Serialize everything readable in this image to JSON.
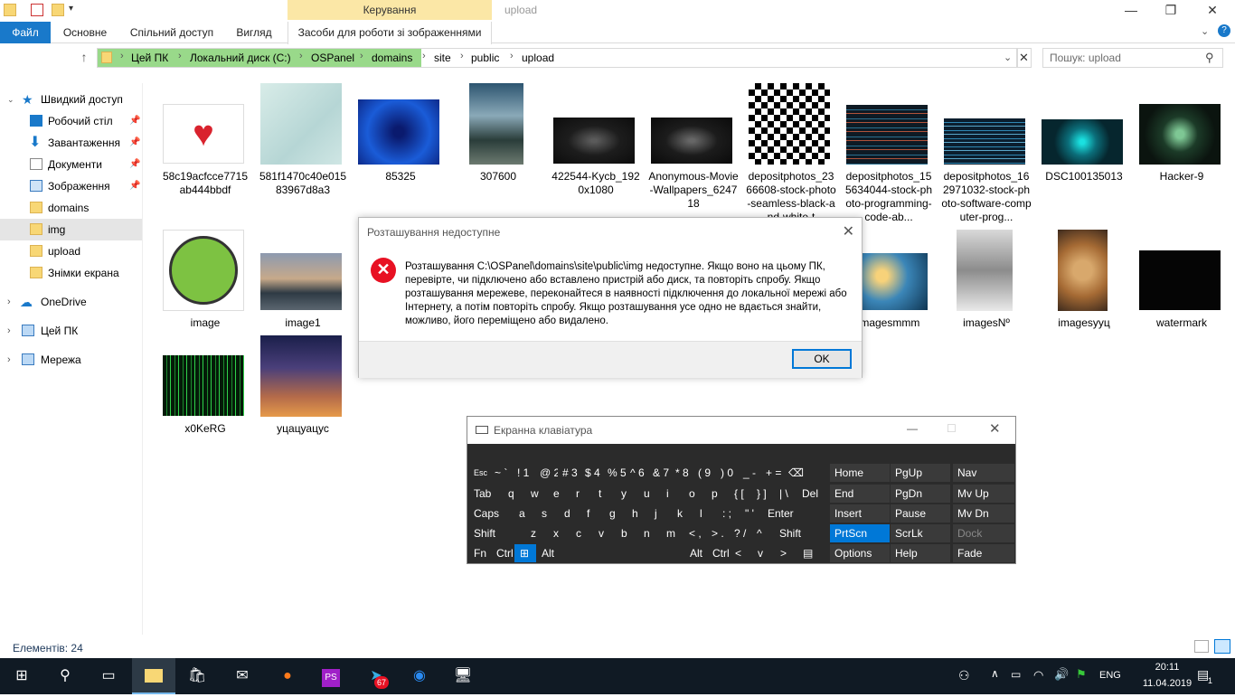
{
  "window": {
    "title": "upload",
    "manage_tab": "Керування"
  },
  "ribbon": {
    "tabs": [
      "Файл",
      "Основне",
      "Спільний доступ",
      "Вигляд",
      "Засоби для роботи зі зображеннями"
    ]
  },
  "address": {
    "crumbs": [
      "Цей ПК",
      "Локальний диск (C:)",
      "OSPanel",
      "domains",
      "site",
      "public",
      "upload"
    ]
  },
  "search": {
    "placeholder": "Пошук: upload"
  },
  "sidebar": {
    "quick_access": "Швидкий доступ",
    "items": [
      "Робочий стіл",
      "Завантаження",
      "Документи",
      "Зображення",
      "domains",
      "img",
      "upload",
      "Знімки екрана"
    ],
    "onedrive": "OneDrive",
    "this_pc": "Цей ПК",
    "network": "Мережа"
  },
  "files": [
    {
      "name": "58c19acfcce7715ab444bbdf"
    },
    {
      "name": "581f1470c40e01583967d8a3"
    },
    {
      "name": "85325"
    },
    {
      "name": "307600"
    },
    {
      "name": "422544-Kycb_1920x1080"
    },
    {
      "name": "Anonymous-Movie-Wallpapers_624718"
    },
    {
      "name": "depositphotos_2366608-stock-photo-seamless-black-and-white-t"
    },
    {
      "name": "depositphotos_155634044-stock-photo-programming-code-ab..."
    },
    {
      "name": "depositphotos_162971032-stock-photo-software-computer-prog..."
    },
    {
      "name": "DSC100135013"
    },
    {
      "name": "Hacker-9"
    },
    {
      "name": "image"
    },
    {
      "name": "image1"
    },
    {
      "name": "imagesmmm"
    },
    {
      "name": "imagesNº"
    },
    {
      "name": "imagesyyц"
    },
    {
      "name": "watermark"
    },
    {
      "name": "x0KeRG"
    },
    {
      "name": "уцацуацус"
    }
  ],
  "status": {
    "count_text": "Елементів: 24"
  },
  "dialog": {
    "title": "Розташування недоступне",
    "message": "Розташування C:\\OSPanel\\domains\\site\\public\\img недоступне. Якщо воно на цьому ПК, перевірте, чи підключено або вставлено пристрій або диск, та повторіть спробу. Якщо розташування мережеве, переконайтеся в наявності підключення до локальної мережі або Інтернету, а потім повторіть спробу. Якщо розташування усе одно не вдається знайти, можливо, його переміщено або видалено.",
    "ok": "OK"
  },
  "osk": {
    "title": "Екранна клавіатура",
    "row1": [
      "Esc",
      "~ `",
      "! 1",
      "@ 2",
      "# 3",
      "$ 4",
      "% 5",
      "^ 6",
      "& 7",
      "* 8",
      "( 9",
      ") 0",
      "_ -",
      "+ ="
    ],
    "row2": [
      "Tab",
      "q",
      "w",
      "e",
      "r",
      "t",
      "y",
      "u",
      "i",
      "o",
      "p",
      "{ [",
      "} ]",
      "| \\",
      "Del"
    ],
    "row3": [
      "Caps",
      "a",
      "s",
      "d",
      "f",
      "g",
      "h",
      "j",
      "k",
      "l",
      ": ;",
      "\" '",
      "Enter"
    ],
    "row4": [
      "Shift",
      "z",
      "x",
      "c",
      "v",
      "b",
      "n",
      "m",
      "< ,",
      "> .",
      "? /",
      "^",
      "Shift"
    ],
    "row5": [
      "Fn",
      "Ctrl",
      "Alt",
      "Alt",
      "Ctrl",
      "<",
      "v",
      ">"
    ],
    "nav": [
      [
        "Home",
        "PgUp",
        "Nav"
      ],
      [
        "End",
        "PgDn",
        "Mv Up"
      ],
      [
        "Insert",
        "Pause",
        "Mv Dn"
      ],
      [
        "PrtScn",
        "ScrLk",
        "Dock"
      ],
      [
        "Options",
        "Help",
        "Fade"
      ]
    ]
  },
  "taskbar": {
    "lang": "ENG",
    "time": "20:11",
    "date": "11.04.2019",
    "telegram_badge": "67",
    "notif": "1"
  },
  "colors": {
    "accent": "#0078d7",
    "file_tab": "#1979ca",
    "path_highlight": "#99d98a",
    "error": "#e81123"
  }
}
